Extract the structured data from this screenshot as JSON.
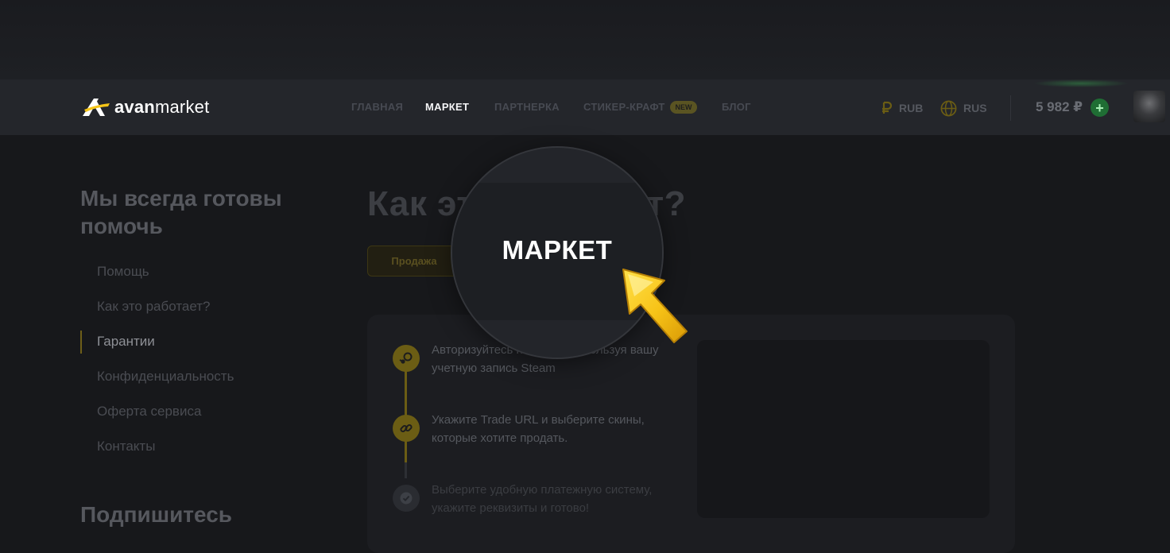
{
  "brand": {
    "name_bold": "avan",
    "name_light": "market"
  },
  "nav": {
    "items": [
      {
        "label": "ГЛАВНАЯ"
      },
      {
        "label": "МАРКЕТ"
      },
      {
        "label": "ПАРТНЕРКА"
      },
      {
        "label": "СТИКЕР-КРАФТ"
      },
      {
        "label": "БЛОГ"
      }
    ],
    "badge": "NEW",
    "active": "МАРКЕТ"
  },
  "header": {
    "currency": "RUB",
    "language": "RUS",
    "balance": "5 982 ₽",
    "add_funds": "+"
  },
  "sidebar": {
    "title": "Мы всегда готовы помочь",
    "links": [
      {
        "label": "Помощь"
      },
      {
        "label": "Как это работает?"
      },
      {
        "label": "Гарантии"
      },
      {
        "label": "Конфиденциальность"
      },
      {
        "label": "Оферта сервиса"
      },
      {
        "label": "Контакты"
      }
    ],
    "active_link": "Гарантии",
    "subscribe_title": "Подпишитесь"
  },
  "main": {
    "title": "Как это работает?",
    "tabs": [
      {
        "label": "Продажа"
      }
    ],
    "steps": [
      {
        "text": "Авторизуйтесь на сайте, используя вашу учетную запись Steam"
      },
      {
        "text": "Укажите Trade URL и выберите скины, которые хотите продать."
      },
      {
        "text": "Выберите удобную платежную систему, укажите реквизиты и готово!"
      }
    ]
  },
  "overlay": {
    "zoom_label": "МАРКЕТ"
  },
  "colors": {
    "accent": "#f5c518",
    "success": "#2fbf54",
    "background": "#17181b"
  }
}
